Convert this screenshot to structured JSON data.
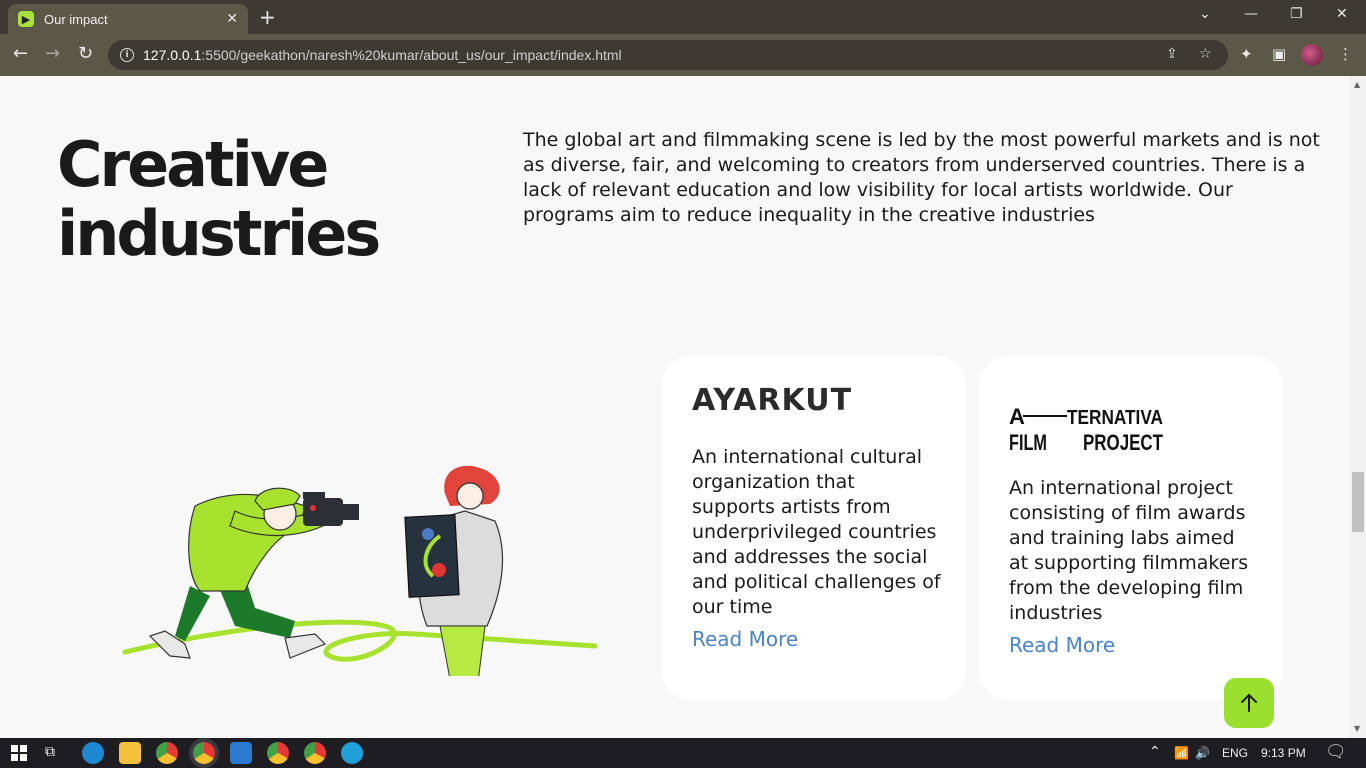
{
  "browser": {
    "tab_title": "Our impact",
    "url_host": "127.0.0.1",
    "url_rest": ":5500/geekathon/naresh%20kumar/about_us/our_impact/index.html"
  },
  "page": {
    "heading_line1": "Creative",
    "heading_line2": "industries",
    "intro": "The global art and filmmaking scene is led by the most powerful markets and is not as diverse, fair, and welcoming to creators from underserved countries. There is a lack of relevant education and low visibility for local artists worldwide. Our programs aim to reduce inequality in the creative industries",
    "cards": [
      {
        "logo": "AYARKUT",
        "text": "An international cultural organization that supports artists from underprivileged countries and addresses the social and political challenges of our time",
        "link": "Read More"
      },
      {
        "logo_line1_left": "A",
        "logo_line1_right": "TERNATIVA",
        "logo_line2_left": "FILM",
        "logo_line2_right": "PROJECT",
        "text": "An international project consisting of film awards and training labs aimed at supporting filmmakers from the developing film industries",
        "link": "Read More"
      }
    ]
  },
  "taskbar": {
    "lang": "ENG",
    "time": "9:13 PM"
  },
  "colors": {
    "accent": "#9be02e",
    "link": "#4a83c8"
  }
}
